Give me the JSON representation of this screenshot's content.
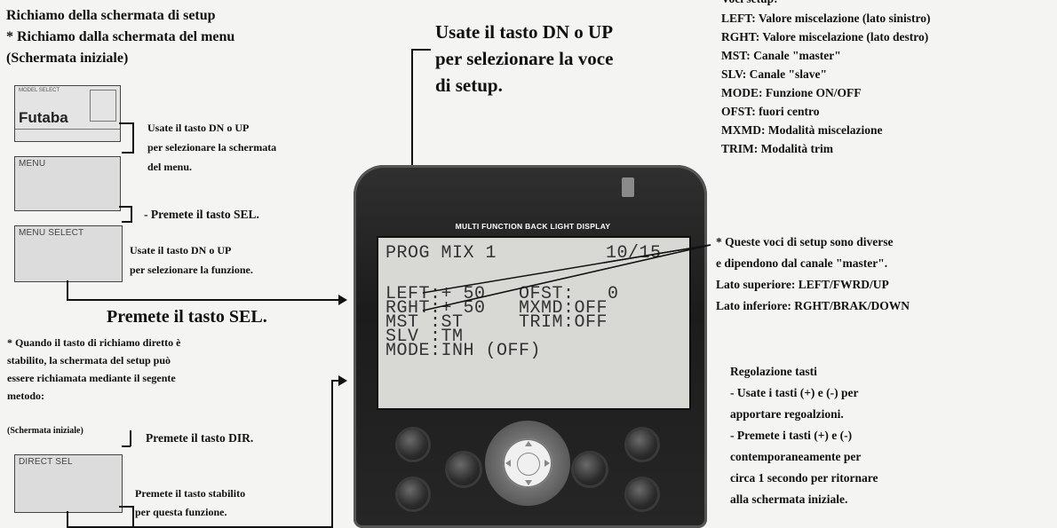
{
  "left_column": {
    "title": "Richiamo della schermata di setup",
    "subtitle": "* Richiamo dalla schermata del menu",
    "subtitle2": "(Schermata iniziale)",
    "initial_screen": {
      "logo": "Futaba",
      "model": "MODEL SELECT"
    },
    "menu_panel": "MENU",
    "menu_select_panel": "MENU SELECT",
    "direct_sel_panel": "DIRECT SEL",
    "step1_line1": "Usate il tasto DN o UP",
    "step1_line2": "per selezionare la schermata",
    "step1_line3": "del menu.",
    "step2": "- Premete il tasto SEL.",
    "step3_line1": "Usate il tasto DN o UP",
    "step3_line2": "per selezionare la funzione.",
    "press_sel": "Premete il tasto SEL.",
    "note_line1": "* Quando il tasto di richiamo diretto è",
    "note_line2": "stabilito, la schermata del setup può",
    "note_line3": "essere richiamata mediante il segente",
    "note_line4": "metodo:",
    "initial_label": "(Schermata iniziale)",
    "press_dir": "Premete il tasto DIR.",
    "press_set_line1": "Premete il tasto stabilito",
    "press_set_line2": "per questa funzione."
  },
  "center": {
    "instruction_line1": "Usate il tasto DN o UP",
    "instruction_line2": "per selezionare la voce",
    "instruction_line3": "di setup.",
    "device_header": "MULTI FUNCTION BACK LIGHT DISPLAY",
    "lcd": {
      "title": "PROG MIX 1",
      "page": "10/15",
      "row1": "LEFT:+ 50   OFST:   0",
      "row2": "RGHT:+ 50   MXMD:OFF",
      "row3": "MST :ST     TRIM:OFF",
      "row4": "SLV :TM",
      "row5": "MODE:INH (OFF)"
    }
  },
  "right_column": {
    "setup_header": "Voci setup:",
    "items": [
      "LEFT: Valore miscelazione (lato sinistro)",
      "RGHT: Valore miscelazione (lato destro)",
      "MST: Canale \"master\"",
      "SLV: Canale \"slave\"",
      "MODE: Funzione ON/OFF",
      "OFST: fuori centro",
      "MXMD: Modalità miscelazione",
      "TRIM: Modalità trim"
    ],
    "note_line1": "* Queste voci di setup sono diverse",
    "note_line2": "e dipendono dal canale \"master\".",
    "note_line3": "Lato superiore: LEFT/FWRD/UP",
    "note_line4": "Lato inferiore: RGHT/BRAK/DOWN",
    "adjust_title": "Regolazione tasti",
    "adjust_line1": "- Usate i tasti (+) e (-) per",
    "adjust_line2": "apportare regoalzioni.",
    "adjust_line3": "- Premete i tasti (+) e (-)",
    "adjust_line4": "contemporaneamente per",
    "adjust_line5": "circa 1 secondo per ritornare",
    "adjust_line6": "alla schermata iniziale."
  }
}
